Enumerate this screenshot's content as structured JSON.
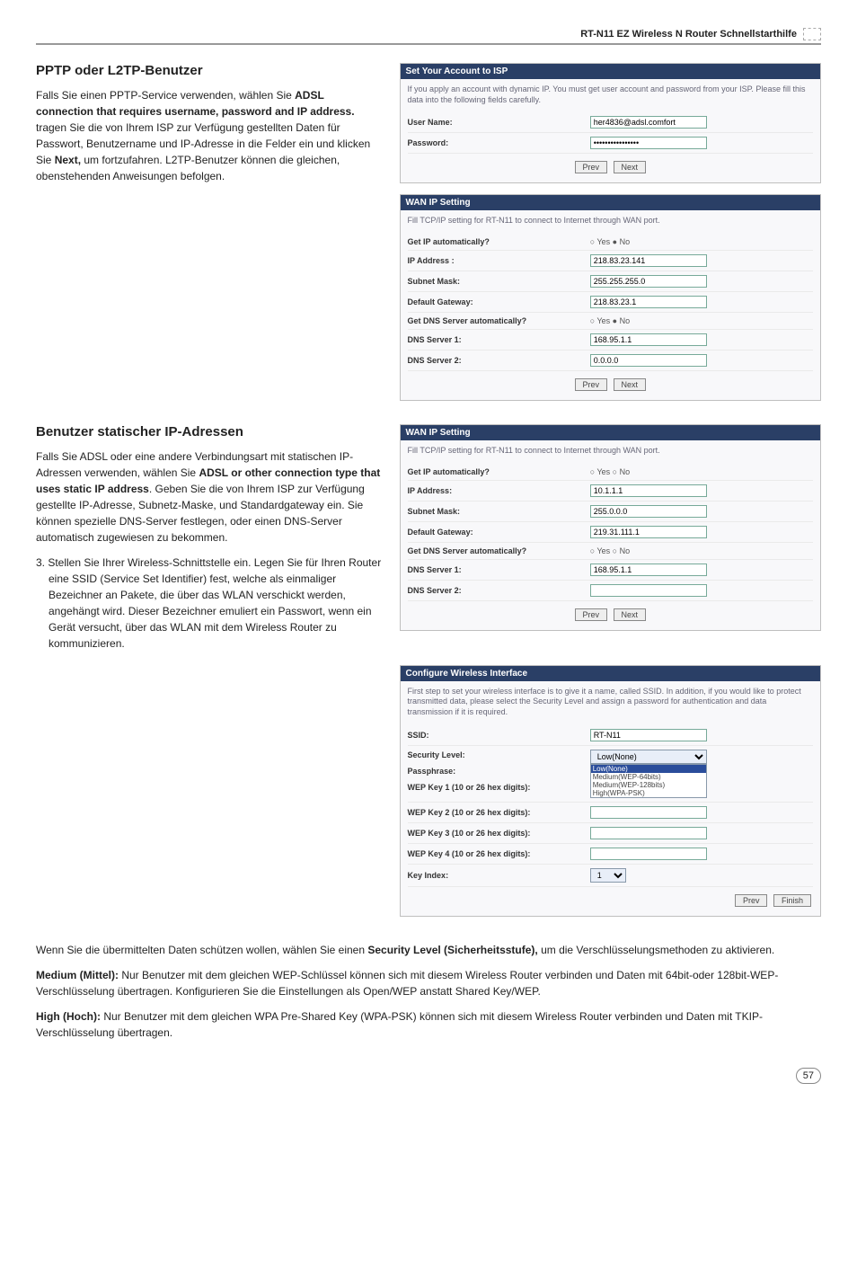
{
  "header": {
    "title": "RT-N11 EZ Wireless N Router Schnellstarthilfe"
  },
  "section1": {
    "heading": "PPTP oder L2TP-Benutzer",
    "para1_a": "Falls Sie einen PPTP-Service verwenden, wählen Sie ",
    "para1_bold": "ADSL connection that requires username, password and IP address.",
    "para1_b": " tragen Sie die von Ihrem ISP zur Verfügung gestellten Daten für Passwort, Benutzername und IP-Adresse in die Felder ein und klicken Sie ",
    "para1_next": "Next,",
    "para1_c": " um fortzufahren. L2TP-Benutzer können die gleichen, obenstehenden Anweisungen befolgen."
  },
  "section2": {
    "heading": "Benutzer statischer IP-Adressen",
    "para1_a": "Falls Sie ADSL oder eine andere Verbindungsart mit statischen IP-Adressen verwenden, wählen Sie ",
    "para1_bold": "ADSL or other connection type that uses static IP address",
    "para1_b": ". Geben Sie die von Ihrem ISP zur Verfügung gestellte IP-Adresse, Subnetz-Maske, und Standardgateway ein. Sie können spezielle DNS-Server festlegen, oder einen DNS-Server automatisch zugewiesen zu bekommen.",
    "list_item3": "3.  Stellen Sie Ihrer Wireless-Schnittstelle ein. Legen Sie für Ihren Router eine SSID (Service Set Identifier) fest, welche als einmaliger Bezeichner an Pakete, die über das WLAN verschickt werden, angehängt wird. Dieser Bezeichner emuliert ein Passwort, wenn ein Gerät versucht, über das WLAN mit dem Wireless Router zu kommunizieren."
  },
  "panel_isp": {
    "title": "Set Your Account to ISP",
    "desc": "If you apply an account with dynamic IP. You must get user account and password from your ISP. Please fill this data into the following fields carefully.",
    "user_label": "User Name:",
    "user_value": "her4836@adsl.comfort",
    "pass_label": "Password:",
    "pass_value": "****************",
    "prev": "Prev",
    "next": "Next"
  },
  "panel_wan1": {
    "title": "WAN IP Setting",
    "desc": "Fill TCP/IP setting for RT-N11 to connect to Internet through WAN port.",
    "ip_auto_label": "Get IP automatically?",
    "ip_auto_val": "○ Yes  ● No",
    "ip_label": "IP Address  :",
    "ip_val": "218.83.23.141",
    "mask_label": "Subnet Mask:",
    "mask_val": "255.255.255.0",
    "gw_label": "Default Gateway:",
    "gw_val": "218.83.23.1",
    "dns_auto_label": "Get DNS Server automatically?",
    "dns_auto_val": "○ Yes  ● No",
    "dns1_label": "DNS Server 1:",
    "dns1_val": "168.95.1.1",
    "dns2_label": "DNS Server 2:",
    "dns2_val": "0.0.0.0",
    "prev": "Prev",
    "next": "Next"
  },
  "panel_wan2": {
    "title": "WAN IP Setting",
    "desc": "Fill TCP/IP setting for RT-N11 to connect to Internet through WAN port.",
    "ip_auto_label": "Get IP automatically?",
    "ip_auto_val": "○ Yes ○ No",
    "ip_label": "IP Address:",
    "ip_val": "10.1.1.1",
    "mask_label": "Subnet Mask:",
    "mask_val": "255.0.0.0",
    "gw_label": "Default Gateway:",
    "gw_val": "219.31.111.1",
    "dns_auto_label": "Get DNS Server automatically?",
    "dns_auto_val": "○ Yes ○ No",
    "dns1_label": "DNS Server 1:",
    "dns1_val": "168.95.1.1",
    "dns2_label": "DNS Server 2:",
    "dns2_val": "",
    "prev": "Prev",
    "next": "Next"
  },
  "panel_wifi": {
    "title": "Configure Wireless Interface",
    "desc": "First step to set your wireless interface is to give it a name, called SSID. In addition, if you would like to protect transmitted data, please select the Security Level and assign a password for authentication and data transmission if it is required.",
    "ssid_label": "SSID:",
    "ssid_val": "RT-N11",
    "sec_label": "Security Level:",
    "sec_val": "Low(None)",
    "opt1": "Low(None)",
    "opt2": "Medium(WEP-64bits)",
    "opt3": "Medium(WEP-128bits)",
    "opt4": "High(WPA-PSK)",
    "pass_label": "Passphrase:",
    "wep1_label": "WEP Key 1 (10 or 26 hex digits):",
    "wep2_label": "WEP Key 2 (10 or 26 hex digits):",
    "wep3_label": "WEP Key 3 (10 or 26 hex digits):",
    "wep4_label": "WEP Key 4 (10 or 26 hex digits):",
    "key_idx_label": "Key Index:",
    "key_idx_val": "1",
    "prev": "Prev",
    "finish": "Finish"
  },
  "bottom": {
    "p1_a": "Wenn Sie die übermittelten Daten schützen wollen, wählen Sie einen ",
    "p1_bold": "Security Level (Sicherheitsstufe),",
    "p1_b": " um die Verschlüsselungsmethoden zu aktivieren.",
    "p2_bold": "Medium (Mittel):",
    "p2": " Nur Benutzer mit dem gleichen WEP-Schlüssel können sich mit diesem Wireless Router verbinden und Daten mit 64bit-oder 128bit-WEP-Verschlüsselung übertragen. Konfigurieren Sie die Einstellungen als Open/WEP anstatt Shared Key/WEP.",
    "p3_bold": "High (Hoch):",
    "p3": " Nur Benutzer mit dem gleichen WPA  Pre-Shared Key (WPA-PSK) können sich mit diesem Wireless Router verbinden und Daten mit TKIP-Verschlüsselung übertragen."
  },
  "page_number": "57"
}
